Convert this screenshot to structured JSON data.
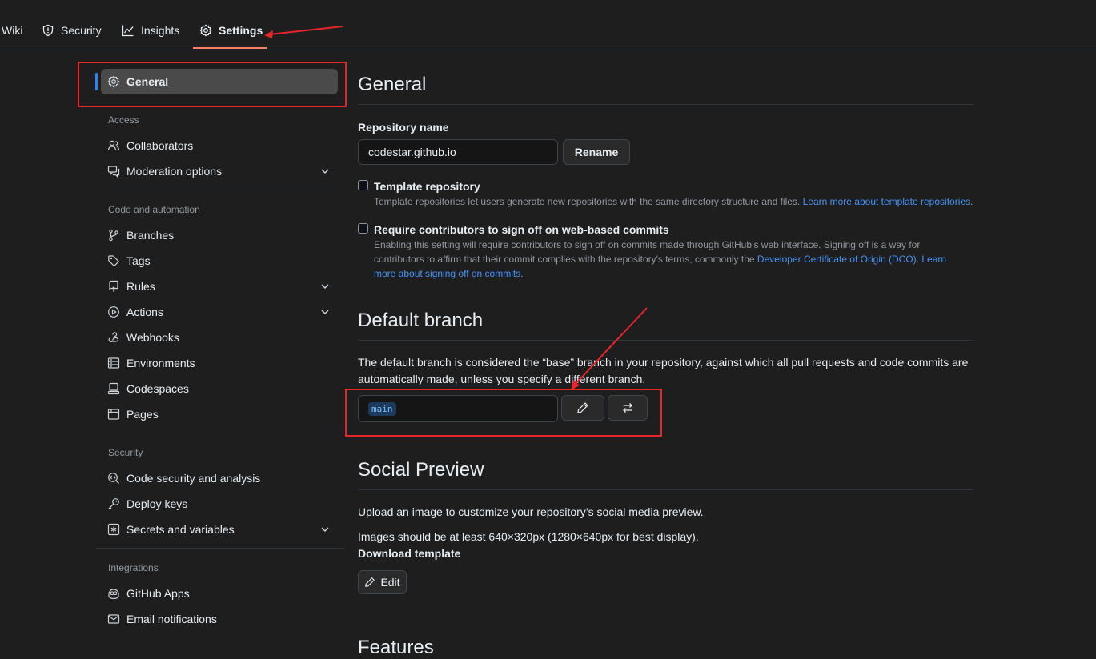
{
  "topnav": {
    "tabs": [
      {
        "label": "Wiki",
        "icon": "book-icon"
      },
      {
        "label": "Security",
        "icon": "shield-icon"
      },
      {
        "label": "Insights",
        "icon": "graph-icon"
      },
      {
        "label": "Settings",
        "icon": "gear-icon",
        "active": true
      }
    ]
  },
  "sidebar": {
    "general": "General",
    "sections": [
      {
        "heading": "Access",
        "items": [
          "Collaborators",
          "Moderation options"
        ]
      },
      {
        "heading": "Code and automation",
        "items": [
          "Branches",
          "Tags",
          "Rules",
          "Actions",
          "Webhooks",
          "Environments",
          "Codespaces",
          "Pages"
        ]
      },
      {
        "heading": "Security",
        "items": [
          "Code security and analysis",
          "Deploy keys",
          "Secrets and variables"
        ]
      },
      {
        "heading": "Integrations",
        "items": [
          "GitHub Apps",
          "Email notifications"
        ]
      }
    ]
  },
  "main": {
    "general_title": "General",
    "repo_name_label": "Repository name",
    "repo_name_value": "codestar.github.io",
    "rename_button": "Rename",
    "template_label": "Template repository",
    "template_note": "Template repositories let users generate new repositories with the same directory structure and files.",
    "template_link": "Learn more about template repositories",
    "template_note_end": ".",
    "signoff_label": "Require contributors to sign off on web-based commits",
    "signoff_note_1": "Enabling this setting will require contributors to sign off on commits made through GitHub’s web interface. Signing off is a way for contributors to affirm that their commit complies with the repository's terms, commonly the",
    "signoff_link_1": "Developer Certificate of Origin (DCO)",
    "signoff_note_2": ".",
    "signoff_link_2": "Learn more about signing off on commits",
    "signoff_note_3": ".",
    "default_branch_title": "Default branch",
    "default_branch_desc": "The default branch is considered the “base” branch in your repository, against which all pull requests and code commits are automatically made, unless you specify a different branch.",
    "default_branch_value": "main",
    "social_title": "Social Preview",
    "social_desc": "Upload an image to customize your repository’s social media preview.",
    "social_size": "Images should be at least 640×320px (1280×640px for best display).",
    "download_template": "Download template",
    "edit_button": "Edit",
    "features_title": "Features"
  },
  "colors": {
    "background": "#1e1e1e",
    "link": "#4493f8",
    "accent_underline": "#f78166",
    "annotation_red": "#e5262b"
  }
}
